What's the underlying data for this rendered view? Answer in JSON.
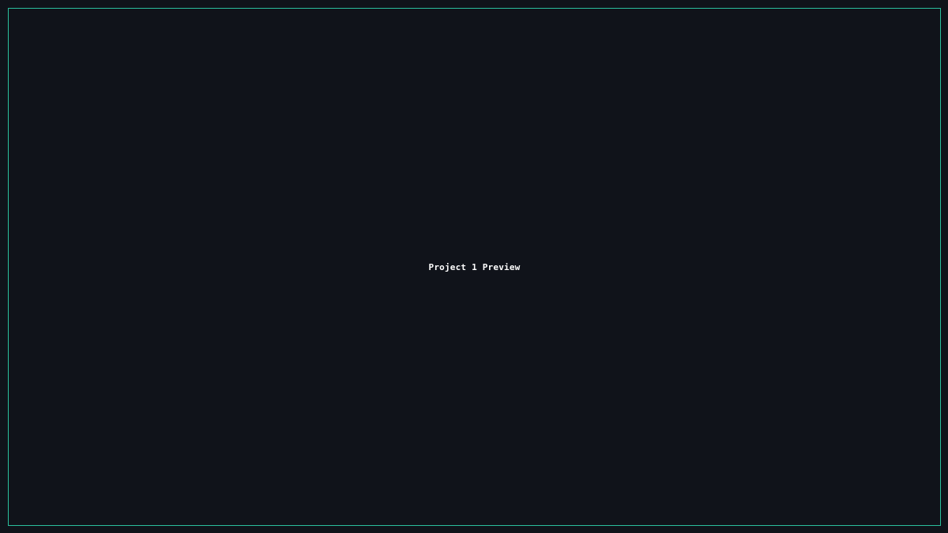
{
  "preview": {
    "label": "Project 1 Preview"
  },
  "colors": {
    "background": "#10131a",
    "frame_border": "#2bbf9d",
    "text": "#ffffff"
  }
}
